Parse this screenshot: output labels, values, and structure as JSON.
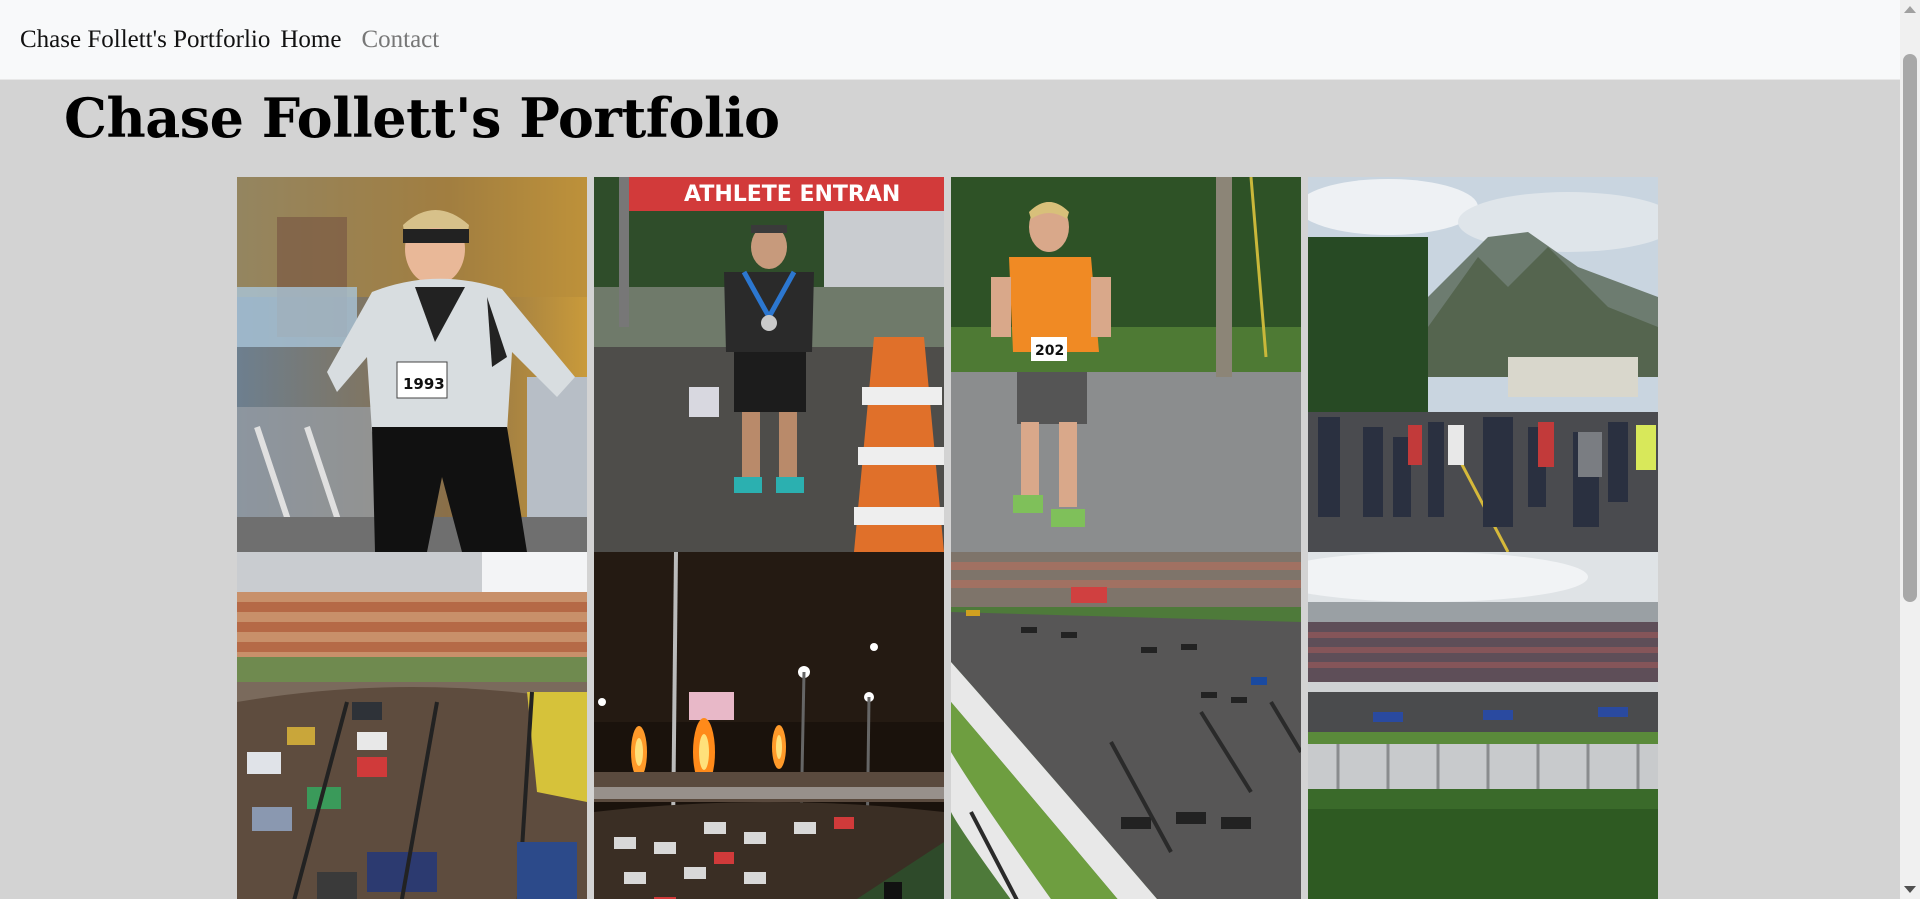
{
  "navbar": {
    "brand": "Chase Follett's Portforlio",
    "links": [
      {
        "label": "Home",
        "active": true
      },
      {
        "label": "Contact",
        "active": false
      }
    ]
  },
  "main": {
    "heading": "Chase Follett's Portfolio"
  },
  "gallery": {
    "photos": [
      {
        "subject": "runner-headband-race",
        "bib": "1993"
      },
      {
        "subject": "finisher-with-medal",
        "banner": "ATHLETE ENTRAN"
      },
      {
        "subject": "runner-orange-shirt",
        "bib": "202"
      },
      {
        "subject": "mountain-road-race"
      },
      {
        "subject": "truck-race-dirt-track"
      },
      {
        "subject": "night-race-fireworks"
      },
      {
        "subject": "indycar-track-turn"
      },
      {
        "subject": "indycar-grandstand-straight"
      }
    ]
  },
  "colors": {
    "page_background": "#d3d3d3",
    "navbar_background": "#f8f9fa",
    "link_inactive": "#777777"
  }
}
